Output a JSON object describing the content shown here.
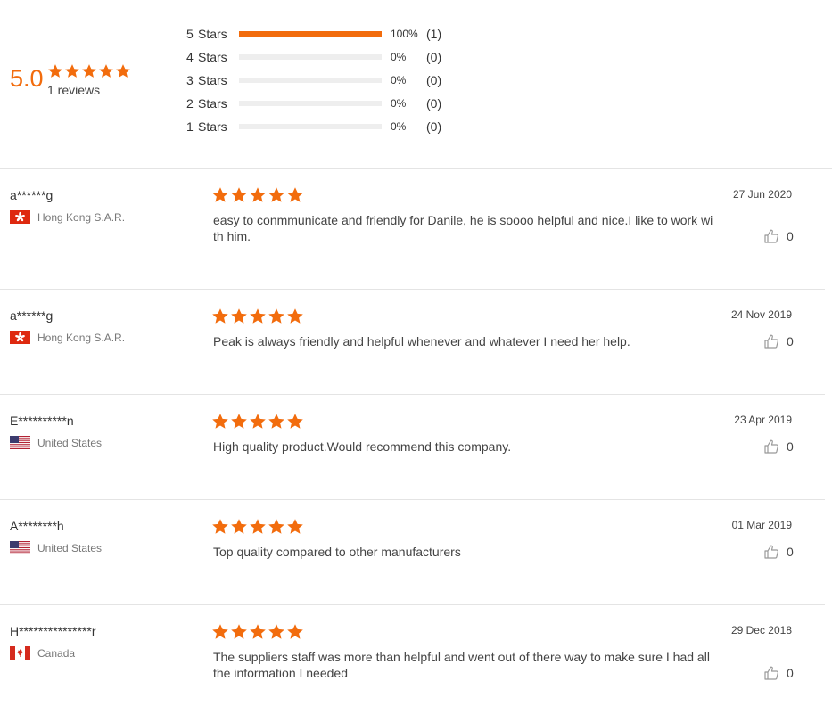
{
  "summary": {
    "score": "5.0",
    "rating": 5,
    "reviews_label": "1 reviews",
    "distribution": [
      {
        "num": "5",
        "label": "Stars",
        "fraction": 1.0,
        "percent": "100%",
        "count": "(1)"
      },
      {
        "num": "4",
        "label": "Stars",
        "fraction": 0.0,
        "percent": "0%",
        "count": "(0)"
      },
      {
        "num": "3",
        "label": "Stars",
        "fraction": 0.0,
        "percent": "0%",
        "count": "(0)"
      },
      {
        "num": "2",
        "label": "Stars",
        "fraction": 0.0,
        "percent": "0%",
        "count": "(0)"
      },
      {
        "num": "1",
        "label": "Stars",
        "fraction": 0.0,
        "percent": "0%",
        "count": "(0)"
      }
    ]
  },
  "reviews": [
    {
      "user": "a******g",
      "country": "Hong Kong S.A.R.",
      "flag": "hk-flag-icon",
      "rating": 5,
      "text": "easy to conmmunicate and friendly for Danile, he is soooo helpful and nice.I like to work with him.",
      "date": "27 Jun 2020",
      "likes": "0"
    },
    {
      "user": "a******g",
      "country": "Hong Kong S.A.R.",
      "flag": "hk-flag-icon",
      "rating": 5,
      "text": "Peak is always friendly and helpful whenever and whatever I need her help.",
      "date": "24 Nov 2019",
      "likes": "0"
    },
    {
      "user": "E**********n",
      "country": "United States",
      "flag": "us-flag-icon",
      "rating": 5,
      "text": "High quality product.Would recommend this company.",
      "date": "23 Apr 2019",
      "likes": "0"
    },
    {
      "user": "A********h",
      "country": "United States",
      "flag": "us-flag-icon",
      "rating": 5,
      "text": "Top quality compared to other manufacturers",
      "date": "01 Mar 2019",
      "likes": "0"
    },
    {
      "user": "H***************r",
      "country": "Canada",
      "flag": "ca-flag-icon",
      "rating": 5,
      "text": "The suppliers staff was more than helpful and went out of there way to make sure I had all the information I needed",
      "date": "29 Dec 2018",
      "likes": "0"
    }
  ],
  "colors": {
    "accent": "#f26c0d",
    "bar_bg": "#eeeeee",
    "divider": "#e4e4e4"
  }
}
